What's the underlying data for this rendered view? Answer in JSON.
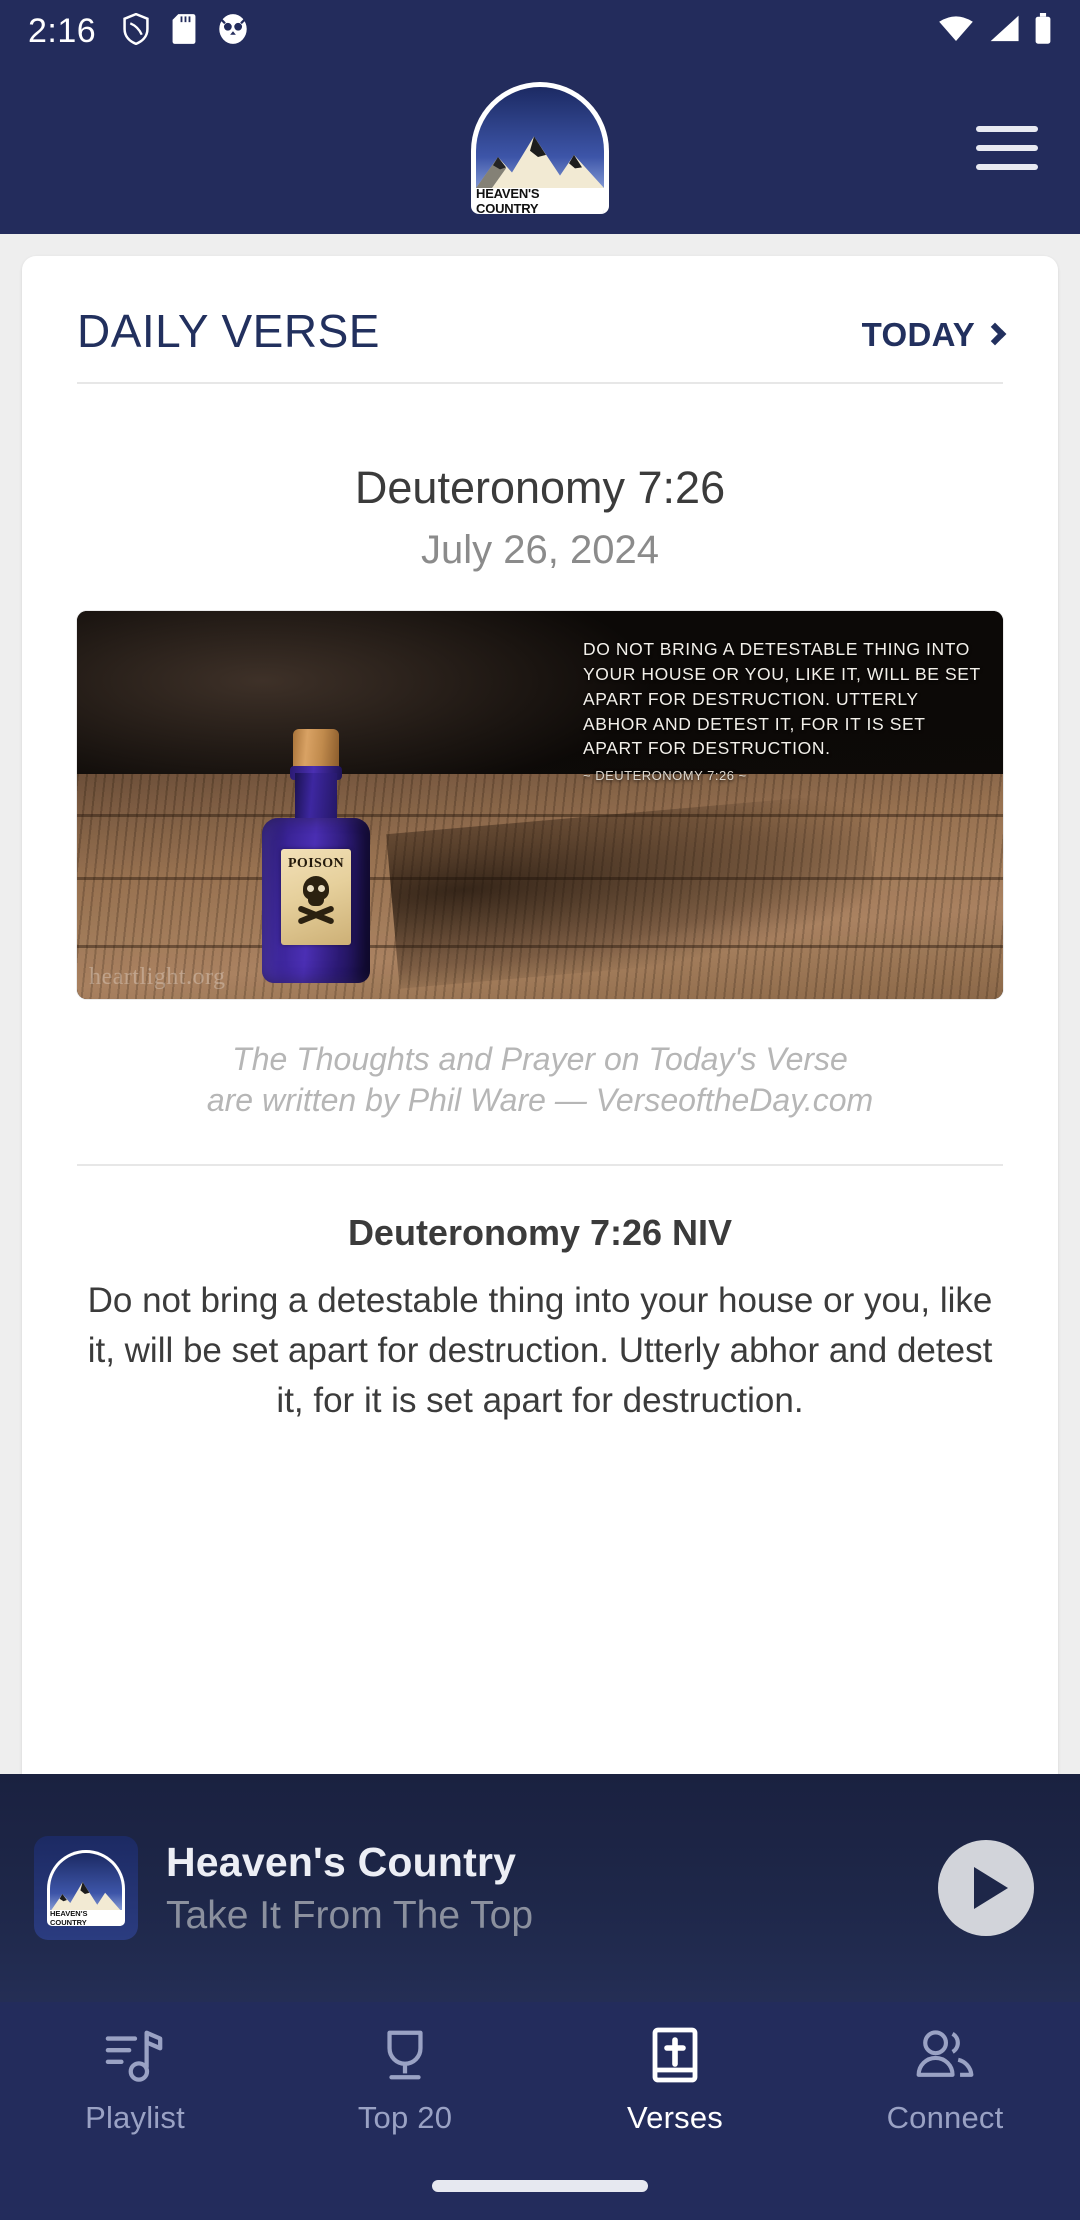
{
  "status_bar": {
    "time": "2:16",
    "left_icons": [
      "shield-icon",
      "sd-card-icon",
      "owl-icon"
    ],
    "right_icons": [
      "wifi-icon",
      "cell-signal-icon",
      "battery-icon"
    ]
  },
  "header": {
    "logo_label": "HEAVEN'S COUNTRY",
    "menu_label": "menu"
  },
  "card": {
    "title": "DAILY VERSE",
    "today_label": "TODAY",
    "verse_reference": "Deuteronomy 7:26",
    "verse_date": "July 26, 2024",
    "image": {
      "overlay_text": "Do not bring a detestable thing into your house or you, like it, will be set apart for destruction. Utterly abhor and detest it, for it is set apart for destruction.",
      "overlay_attribution": "~ Deuteronomy 7:26 ~",
      "bottle_label": "POISON",
      "watermark": "heartlight.org"
    },
    "attribution_line_1": "The Thoughts and Prayer on Today's Verse",
    "attribution_line_2": "are written by Phil Ware — VerseoftheDay.com",
    "scripture_heading": "Deuteronomy 7:26 NIV",
    "scripture_body": "Do not bring a detestable thing into your house or you, like it, will be set apart for destruction. Utterly abhor and detest it, for it is set apart for destruction."
  },
  "player": {
    "title": "Heaven's Country",
    "subtitle": "Take It From The Top",
    "art_label": "HEAVEN'S COUNTRY",
    "play_button": "play"
  },
  "bottom_nav": {
    "items": [
      {
        "label": "Playlist",
        "icon": "music-note-icon",
        "active": false
      },
      {
        "label": "Top 20",
        "icon": "trophy-icon",
        "active": false
      },
      {
        "label": "Verses",
        "icon": "bible-icon",
        "active": true
      },
      {
        "label": "Connect",
        "icon": "people-icon",
        "active": false
      }
    ]
  },
  "colors": {
    "brand_navy": "#232c5c",
    "page_bg": "#eeeeee",
    "card_bg": "#ffffff",
    "muted_text": "#8b8b8b",
    "nav_inactive": "#9aa2c4"
  }
}
